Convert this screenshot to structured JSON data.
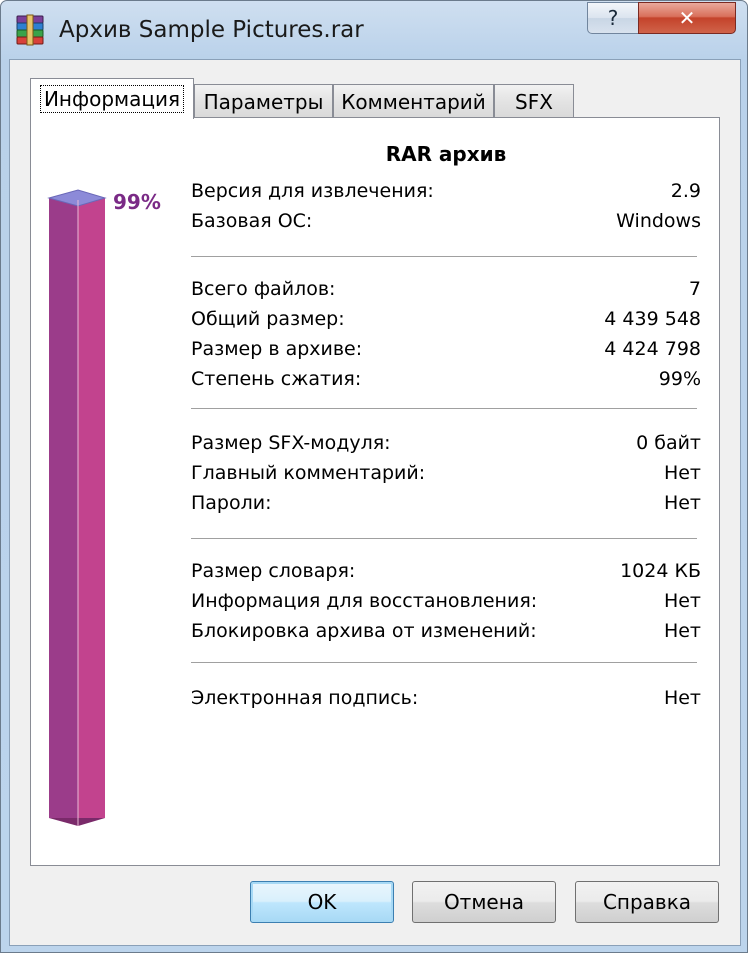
{
  "window": {
    "title": "Архив Sample Pictures.rar",
    "help_glyph": "?",
    "close_glyph": "✕"
  },
  "tabs": [
    {
      "label": "Информация",
      "active": true
    },
    {
      "label": "Параметры",
      "active": false
    },
    {
      "label": "Комментарий",
      "active": false
    },
    {
      "label": "SFX",
      "active": false
    }
  ],
  "compression_bar": {
    "ratio_percent": 99,
    "label": "99%",
    "color": "#c2438e"
  },
  "info": {
    "heading": "RAR архив",
    "groups": [
      [
        {
          "label": "Версия для извлечения:",
          "value": "2.9"
        },
        {
          "label": "Базовая ОС:",
          "value": "Windows"
        }
      ],
      [
        {
          "label": "Всего файлов:",
          "value": "7"
        },
        {
          "label": "Общий размер:",
          "value": "4 439 548"
        },
        {
          "label": "Размер в архиве:",
          "value": "4 424 798"
        },
        {
          "label": "Степень сжатия:",
          "value": "99%"
        }
      ],
      [
        {
          "label": "Размер SFX-модуля:",
          "value": "0 байт"
        },
        {
          "label": "Главный комментарий:",
          "value": "Нет"
        },
        {
          "label": "Пароли:",
          "value": "Нет"
        }
      ],
      [
        {
          "label": "Размер словаря:",
          "value": "1024 КБ"
        },
        {
          "label": "Информация для восстановления:",
          "value": "Нет"
        },
        {
          "label": "Блокировка архива от изменений:",
          "value": "Нет"
        }
      ],
      [
        {
          "label": "Электронная подпись:",
          "value": "Нет"
        }
      ]
    ]
  },
  "buttons": {
    "ok": "OK",
    "cancel": "Отмена",
    "help": "Справка"
  }
}
